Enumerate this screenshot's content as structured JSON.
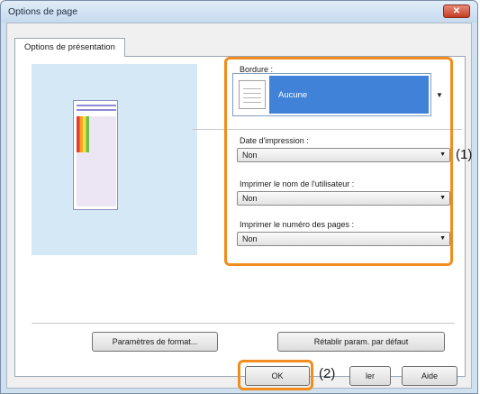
{
  "window": {
    "title": "Options de page",
    "close_symbol": "✕"
  },
  "tab": {
    "label": "Options de présentation"
  },
  "border": {
    "label": "Bordure :",
    "value": "Aucune"
  },
  "print_date": {
    "label": "Date d'impression :",
    "value": "Non"
  },
  "print_user": {
    "label": "Imprimer le nom de l'utilisateur :",
    "value": "Non"
  },
  "print_page_num": {
    "label": "Imprimer le numéro des pages :",
    "value": "Non"
  },
  "buttons": {
    "format_params": "Paramètres de format...",
    "restore_defaults": "Rétablir param. par défaut",
    "ok": "OK",
    "cancel_partial": "ler",
    "help": "Aide"
  },
  "callouts": {
    "one": "(1)",
    "two": "(2)"
  },
  "colors": {
    "highlight_orange": "#f28c1e",
    "selection_blue": "#3f82d8"
  }
}
